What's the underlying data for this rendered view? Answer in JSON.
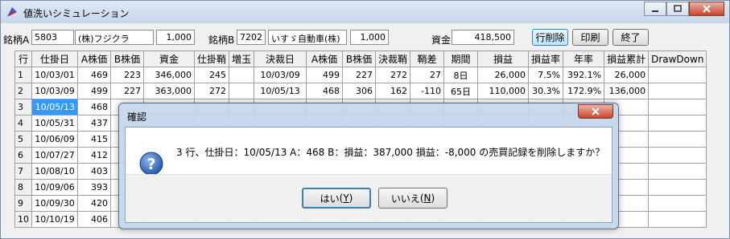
{
  "window": {
    "title": "値洗いシミュレーション",
    "icon": "app-icon"
  },
  "toolbar": {
    "stockA_label": "銘柄A",
    "stockA_code": "5803",
    "stockA_name": "(株)フジクラ",
    "stockA_qty": "1,000",
    "stockB_label": "銘柄B",
    "stockB_code": "7202",
    "stockB_name": "いすゞ自動車(株)",
    "stockB_qty": "1,000",
    "capital_label": "資金",
    "capital_value": "418,500",
    "delete_label": "行削除",
    "print_label": "印刷",
    "exit_label": "終了"
  },
  "grid": {
    "headers": [
      "行",
      "仕掛日",
      "A株価",
      "B株価",
      "資金",
      "仕掛鞘",
      "増玉",
      "決裁日",
      "A株価",
      "B株価",
      "決裁鞘",
      "鞘差",
      "期間",
      "損益",
      "損益率",
      "年率",
      "損益累計",
      "DrawDown"
    ],
    "rows": [
      [
        "1",
        "10/03/01",
        "469",
        "223",
        "346,000",
        "245",
        "",
        "10/03/09",
        "499",
        "227",
        "272",
        "27",
        "8日",
        "26,000",
        "7.5%",
        "392.1%",
        "26,000",
        ""
      ],
      [
        "2",
        "10/03/09",
        "499",
        "227",
        "363,000",
        "272",
        "",
        "10/05/13",
        "468",
        "306",
        "162",
        "-110",
        "65日",
        "110,000",
        "30.3%",
        "172.9%",
        "136,000",
        ""
      ],
      [
        "3",
        "10/05/13",
        "468",
        "",
        "",
        "",
        "",
        "",
        "",
        "",
        "",
        "",
        "",
        "",
        "",
        "",
        "",
        ""
      ],
      [
        "4",
        "10/05/31",
        "437",
        "",
        "",
        "",
        "",
        "",
        "",
        "",
        "",
        "",
        "",
        "",
        "",
        "",
        "",
        ""
      ],
      [
        "5",
        "10/06/09",
        "415",
        "",
        "",
        "",
        "",
        "",
        "",
        "",
        "",
        "",
        "",
        "",
        "",
        "",
        "",
        ""
      ],
      [
        "6",
        "10/07/27",
        "412",
        "",
        "",
        "",
        "",
        "",
        "",
        "",
        "",
        "",
        "",
        "",
        "",
        "",
        "",
        ""
      ],
      [
        "7",
        "10/08/10",
        "403",
        "",
        "",
        "",
        "",
        "",
        "",
        "",
        "",
        "",
        "",
        "",
        "",
        "",
        "",
        ""
      ],
      [
        "8",
        "10/09/06",
        "393",
        "",
        "",
        "",
        "",
        "",
        "",
        "",
        "",
        "",
        "",
        "",
        "",
        "",
        "",
        ""
      ],
      [
        "9",
        "10/09/30",
        "420",
        "",
        "",
        "",
        "",
        "",
        "",
        "",
        "",
        "",
        "",
        "",
        "",
        "",
        "",
        ""
      ],
      [
        "10",
        "10/10/19",
        "406",
        "",
        "",
        "",
        "",
        "",
        "",
        "",
        "",
        "",
        "",
        "",
        "",
        "",
        "",
        ""
      ]
    ]
  },
  "dialog": {
    "title": "確認",
    "message": "3 行、仕掛日：10/05/13 A：468 B：損益：387,000 損益：-8,000 の売買記録を削除しますか？",
    "yes_label": "はい",
    "yes_key": "Y",
    "no_label": "いいえ",
    "no_key": "N",
    "icon": "question-icon"
  }
}
